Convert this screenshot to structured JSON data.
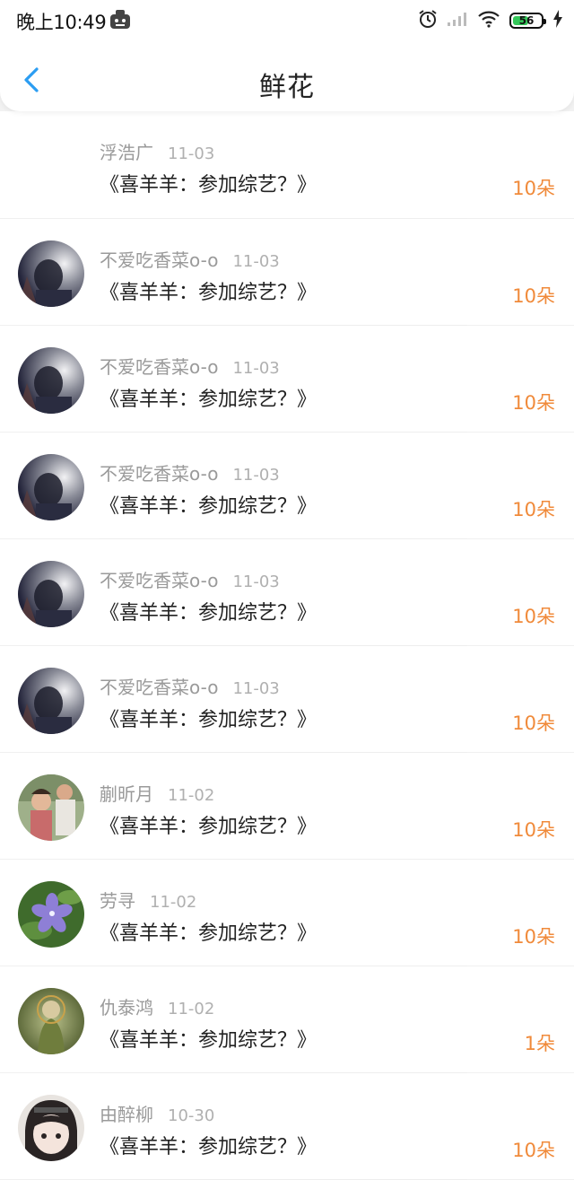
{
  "status": {
    "time": "晚上10:49",
    "battery": "56",
    "battery_level": 0.56,
    "icons": [
      "alarm-icon",
      "signal-icon",
      "wifi-icon",
      "battery-icon",
      "charging-icon"
    ]
  },
  "header": {
    "title": "鲜花",
    "back_icon": "back-arrow-icon"
  },
  "colors": {
    "accent": "#2b9df2",
    "count": "#f08a3a",
    "name": "#9a9a9a"
  },
  "items": [
    {
      "name": "浮浩广",
      "date": "11-03",
      "title": "《喜羊羊：参加综艺？》",
      "count": "10朵",
      "avatar": "none"
    },
    {
      "name": "不爱吃香菜o-o",
      "date": "11-03",
      "title": "《喜羊羊：参加综艺？》",
      "count": "10朵",
      "avatar": "dark-portrait"
    },
    {
      "name": "不爱吃香菜o-o",
      "date": "11-03",
      "title": "《喜羊羊：参加综艺？》",
      "count": "10朵",
      "avatar": "dark-portrait"
    },
    {
      "name": "不爱吃香菜o-o",
      "date": "11-03",
      "title": "《喜羊羊：参加综艺？》",
      "count": "10朵",
      "avatar": "dark-portrait"
    },
    {
      "name": "不爱吃香菜o-o",
      "date": "11-03",
      "title": "《喜羊羊：参加综艺？》",
      "count": "10朵",
      "avatar": "dark-portrait"
    },
    {
      "name": "不爱吃香菜o-o",
      "date": "11-03",
      "title": "《喜羊羊：参加综艺？》",
      "count": "10朵",
      "avatar": "dark-portrait"
    },
    {
      "name": "蒯昕月",
      "date": "11-02",
      "title": "《喜羊羊：参加综艺？》",
      "count": "10朵",
      "avatar": "kids-photo"
    },
    {
      "name": "劳寻",
      "date": "11-02",
      "title": "《喜羊羊：参加综艺？》",
      "count": "10朵",
      "avatar": "purple-flower"
    },
    {
      "name": "仇泰鸿",
      "date": "11-02",
      "title": "《喜羊羊：参加综艺？》",
      "count": "1朵",
      "avatar": "green-statue"
    },
    {
      "name": "由醉柳",
      "date": "10-30",
      "title": "《喜羊羊：参加综艺？》",
      "count": "10朵",
      "avatar": "anime-girl"
    }
  ]
}
